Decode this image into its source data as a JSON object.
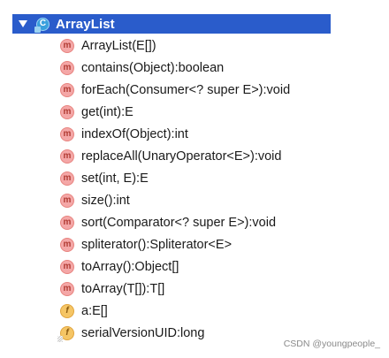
{
  "tree": {
    "class_node": {
      "expanded_icon": "triangle-down-icon",
      "class_icon": "class-icon",
      "name": "ArrayList"
    },
    "members": [
      {
        "kind": "m",
        "label": "ArrayList(E[])"
      },
      {
        "kind": "m",
        "label": "contains(Object):boolean"
      },
      {
        "kind": "m",
        "label": "forEach(Consumer<? super E>):void"
      },
      {
        "kind": "m",
        "label": "get(int):E"
      },
      {
        "kind": "m",
        "label": "indexOf(Object):int"
      },
      {
        "kind": "m",
        "label": "replaceAll(UnaryOperator<E>):void"
      },
      {
        "kind": "m",
        "label": "set(int, E):E"
      },
      {
        "kind": "m",
        "label": "size():int"
      },
      {
        "kind": "m",
        "label": "sort(Comparator<? super E>):void"
      },
      {
        "kind": "m",
        "label": "spliterator():Spliterator<E>"
      },
      {
        "kind": "m",
        "label": "toArray():Object[]"
      },
      {
        "kind": "m",
        "label": "toArray(T[]):T[]"
      },
      {
        "kind": "f",
        "label": "a:E[]"
      },
      {
        "kind": "f",
        "label": "serialVersionUID:long"
      }
    ]
  },
  "watermark": "CSDN @youngpeople_",
  "colors": {
    "selection_bg": "#2a5ccb",
    "method_icon": "#f4a7a7",
    "field_icon": "#f5c565"
  }
}
